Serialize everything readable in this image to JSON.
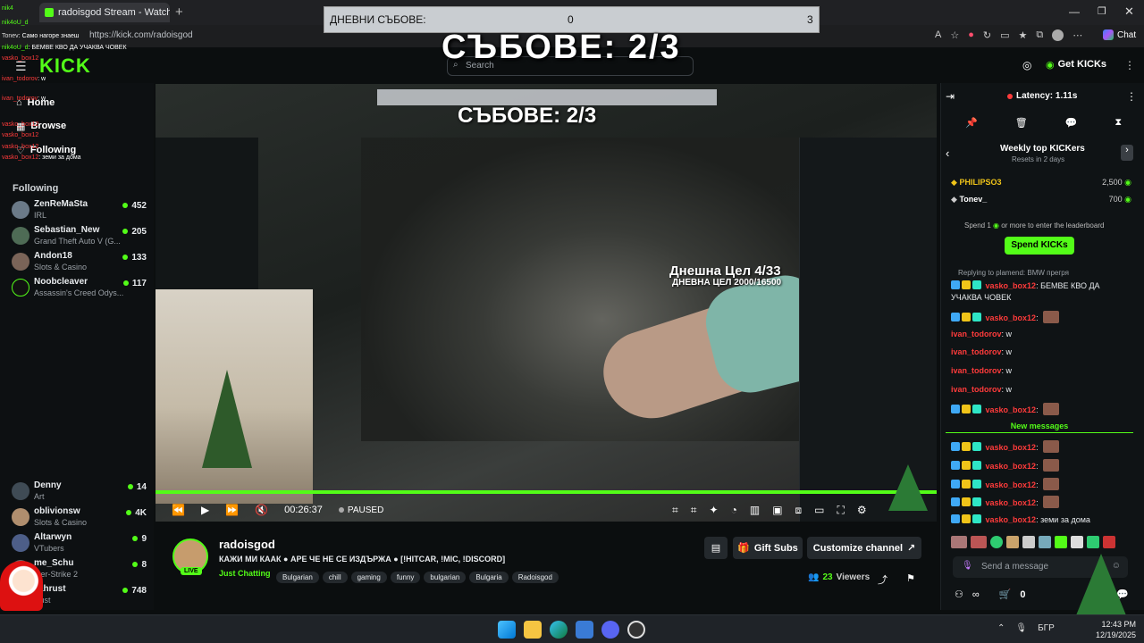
{
  "browser": {
    "tab_title": "radoisgod Stream - Watch Live on",
    "url": "https://kick.com/radoisgod",
    "copilot_label": "Chat"
  },
  "overlay": {
    "bar_label": "ДНЕВНИ СЪБОВЕ:",
    "bar_min": "0",
    "bar_max": "3",
    "title": "СЪБОВЕ: 2/3",
    "inner_goal_1": "Днешна Цел 4/33",
    "inner_goal_2": "ДНЕВНА ЦЕЛ 2000/16500"
  },
  "topnav": {
    "logo": "KICK",
    "search_placeholder": "Search",
    "get_kicks": "Get KICKs"
  },
  "sidebar": {
    "nav": [
      {
        "label": "Home"
      },
      {
        "label": "Browse"
      },
      {
        "label": "Following"
      }
    ],
    "following_header": "Following",
    "following": [
      {
        "name": "ZenReMaSta",
        "game": "IRL",
        "viewers": "452"
      },
      {
        "name": "Sebastian_New",
        "game": "Grand Theft Auto V (G...",
        "viewers": "205"
      },
      {
        "name": "Andon18",
        "game": "Slots & Casino",
        "viewers": "133"
      },
      {
        "name": "Noobcleaver",
        "game": "Assassin's Creed Odys...",
        "viewers": "117"
      }
    ],
    "following_lower": [
      {
        "name": "Denny",
        "game": "Art",
        "viewers": "14"
      },
      {
        "name": "oblivionsw",
        "game": "Slots & Casino",
        "viewers": "4K"
      },
      {
        "name": "Altarwyn",
        "game": "VTubers",
        "viewers": "9"
      },
      {
        "name": "me_Schu",
        "game": "nter-Strike 2",
        "viewers": "8"
      },
      {
        "name": "zahrust",
        "game": "Rust",
        "viewers": "748"
      }
    ],
    "overlay_chat": [
      {
        "user": "nik4",
        "text": ""
      },
      {
        "user": "nik4oU_d",
        "text": ""
      },
      {
        "user": "Tonev",
        "text": "Само нагоре знаеш"
      },
      {
        "user": "nik4oU_d",
        "text": "БЕМВЕ КВО ДА УЧАКВА ЧОВЕК"
      },
      {
        "user": "vasko_box12",
        "text": ""
      },
      {
        "user": "ivan_todorov",
        "text": "w"
      },
      {
        "user": "ivan_todorov",
        "text": "w"
      },
      {
        "user": "vasko_box12",
        "text": ""
      },
      {
        "user": "vasko_box12",
        "text": ""
      },
      {
        "user": "vasko_box12",
        "text": ""
      },
      {
        "user": "vasko_box12",
        "text": "земи за дома"
      }
    ]
  },
  "player": {
    "time": "00:26:37",
    "state": "PAUSED"
  },
  "streamer": {
    "name": "radoisgod",
    "live_badge": "LIVE",
    "stream_title": "КАЖИ МИ КААК ● АРЕ ЧЕ НЕ СЕ ИЗДЪРЖА ● [!HITCAR, !MIC, !DISCORD]",
    "category": "Just Chatting",
    "tags": [
      "Bulgarian",
      "chill",
      "gaming",
      "funny",
      "bulgarian",
      "Bulgaria",
      "Radoisgod"
    ],
    "gift_subs": "Gift Subs",
    "customize": "Customize channel",
    "viewers_count": "23",
    "viewers_label": "Viewers"
  },
  "chat": {
    "latency": "Latency: 1.11s",
    "leaderboard_title": "Weekly top KICKers",
    "leaderboard_sub": "Resets in 2 days",
    "leaders": [
      {
        "name": "PHILIPSO3",
        "points": "2,500"
      },
      {
        "name": "Tonev_",
        "points": "700"
      }
    ],
    "spend_prompt_a": "Spend 1",
    "spend_prompt_b": "or more to enter the leaderboard",
    "spend_button": "Spend KICKs",
    "reply_to": "Replying to plamend: BMW прегря",
    "messages_top": [
      {
        "user": "vasko_box12",
        "text": "БЕМВЕ КВО ДА",
        "cont": "УЧАКВА ЧОВЕК",
        "color": "#ff3b3b"
      },
      {
        "user": "vasko_box12",
        "text": "",
        "color": "#ff3b3b",
        "emote": true
      },
      {
        "user": "ivan_todorov",
        "text": "w",
        "color": "#ff3b3b"
      },
      {
        "user": "ivan_todorov",
        "text": "w",
        "color": "#ff3b3b"
      },
      {
        "user": "ivan_todorov",
        "text": "w",
        "color": "#ff3b3b"
      },
      {
        "user": "ivan_todorov",
        "text": "w",
        "color": "#ff3b3b"
      },
      {
        "user": "vasko_box12",
        "text": "",
        "color": "#ff3b3b",
        "emote": true
      }
    ],
    "new_messages": "New messages",
    "messages_bottom": [
      {
        "user": "vasko_box12",
        "text": ""
      },
      {
        "user": "vasko_box12",
        "text": ""
      },
      {
        "user": "vasko_box12",
        "text": ""
      },
      {
        "user": "vasko_box12",
        "text": ""
      },
      {
        "user": "vasko_box12",
        "text": "земи за дома"
      }
    ],
    "input_placeholder": "Send a message",
    "points": "0"
  },
  "taskbar": {
    "lang": "БГР",
    "time": "12:43 PM",
    "date": "12/19/2025"
  },
  "colors": {
    "kick_green": "#53fc18",
    "red_user": "#ff3b3b",
    "bg": "#0b0e0f"
  }
}
